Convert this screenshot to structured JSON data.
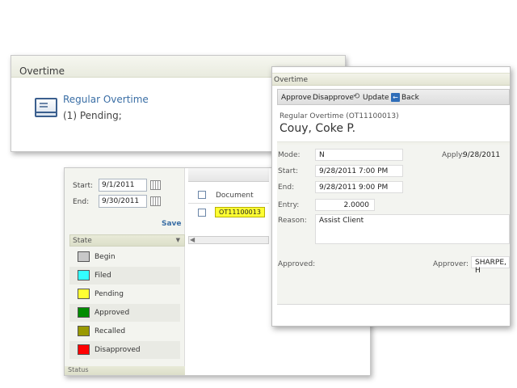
{
  "panelA": {
    "title": "Overtime",
    "link": "Regular Overtime",
    "pending": "(1) Pending;"
  },
  "panelB": {
    "start_label": "Start:",
    "start_value": "9/1/2011",
    "end_label": "End:",
    "end_value": "9/30/2011",
    "save": "Save",
    "state_header": "State",
    "states": [
      {
        "label": "Begin",
        "color": "#c8c8c8"
      },
      {
        "label": "Filed",
        "color": "#33ffff"
      },
      {
        "label": "Pending",
        "color": "#ffff33"
      },
      {
        "label": "Approved",
        "color": "#008c00"
      },
      {
        "label": "Recalled",
        "color": "#999900"
      },
      {
        "label": "Disapproved",
        "color": "#ff0000"
      }
    ],
    "grid_col_document": "Document",
    "grid_row_doc": "OT11100013",
    "status_label": "Status"
  },
  "panelC": {
    "title": "Overtime",
    "toolbar": {
      "approve": "Approve",
      "disapprove": "Disapprove",
      "update": "Update",
      "back": "Back"
    },
    "ot_type": "Regular Overtime  (OT11100013)",
    "employee": "Couy, Coke P.",
    "mode_label": "Mode:",
    "mode_value": "N",
    "apply_label": "Apply:",
    "apply_value": "9/28/2011",
    "start_label": "Start:",
    "start_value": "9/28/2011 7:00 PM",
    "end_label": "End:",
    "end_value": "9/28/2011 9:00 PM",
    "entry_label": "Entry:",
    "entry_value": "2.0000",
    "reason_label": "Reason:",
    "reason_value": "Assist Client",
    "approved_label": "Approved:",
    "approver_label": "Approver:",
    "approver_value": "SHARPE, H"
  }
}
